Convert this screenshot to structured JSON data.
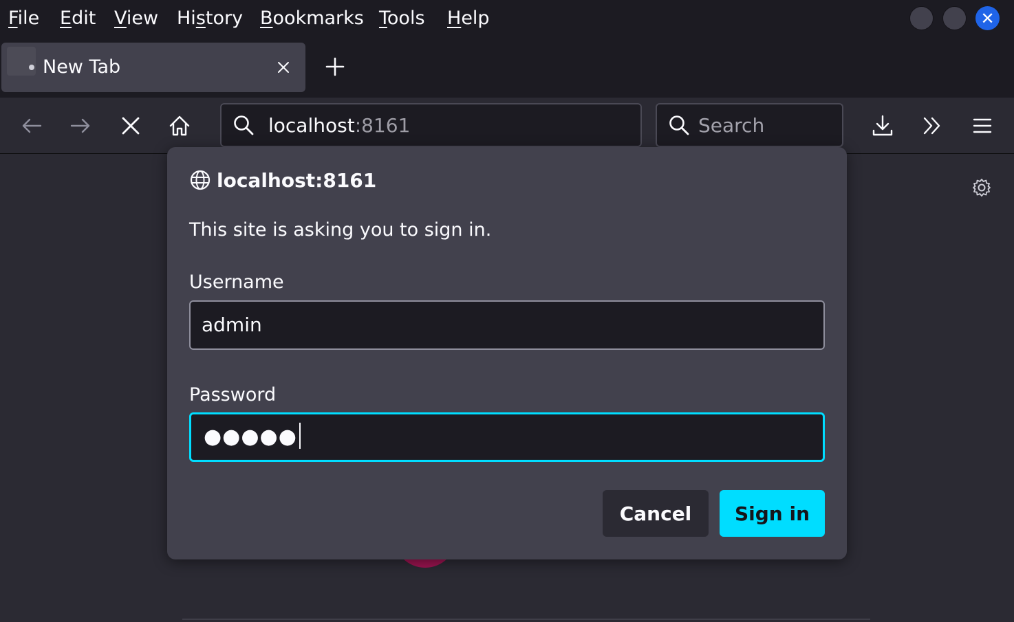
{
  "menubar": {
    "items": [
      {
        "label": "File",
        "accel": "F",
        "rest": "ile"
      },
      {
        "label": "Edit",
        "accel": "E",
        "rest": "dit"
      },
      {
        "label": "View",
        "accel": "V",
        "rest": "iew"
      },
      {
        "label": "History",
        "pre": "Hi",
        "accel": "s",
        "rest": "tory"
      },
      {
        "label": "Bookmarks",
        "accel": "B",
        "rest": "ookmarks"
      },
      {
        "label": "Tools",
        "accel": "T",
        "rest": "ools"
      },
      {
        "label": "Help",
        "accel": "H",
        "rest": "elp"
      }
    ],
    "close_glyph": "✕"
  },
  "tabs": [
    {
      "title": "New Tab",
      "active": true
    }
  ],
  "navbar": {
    "url_host": "localhost",
    "url_port": ":8161",
    "search_placeholder": "Search"
  },
  "dialog": {
    "origin": "localhost:8161",
    "message": "This site is asking you to sign in.",
    "username_label": "Username",
    "username_value": "admin",
    "password_label": "Password",
    "password_masked": "●●●●●",
    "cancel_label": "Cancel",
    "signin_label": "Sign in"
  },
  "colors": {
    "accent": "#00ddff",
    "window_close": "#1f64e8",
    "background": "#2b2a33",
    "dialog": "#42414d"
  },
  "icons": [
    "back-arrow-icon",
    "forward-arrow-icon",
    "stop-icon",
    "home-icon",
    "search-icon",
    "download-icon",
    "overflow-chevrons-icon",
    "hamburger-menu-icon",
    "globe-icon",
    "gear-icon",
    "close-icon",
    "plus-icon"
  ]
}
